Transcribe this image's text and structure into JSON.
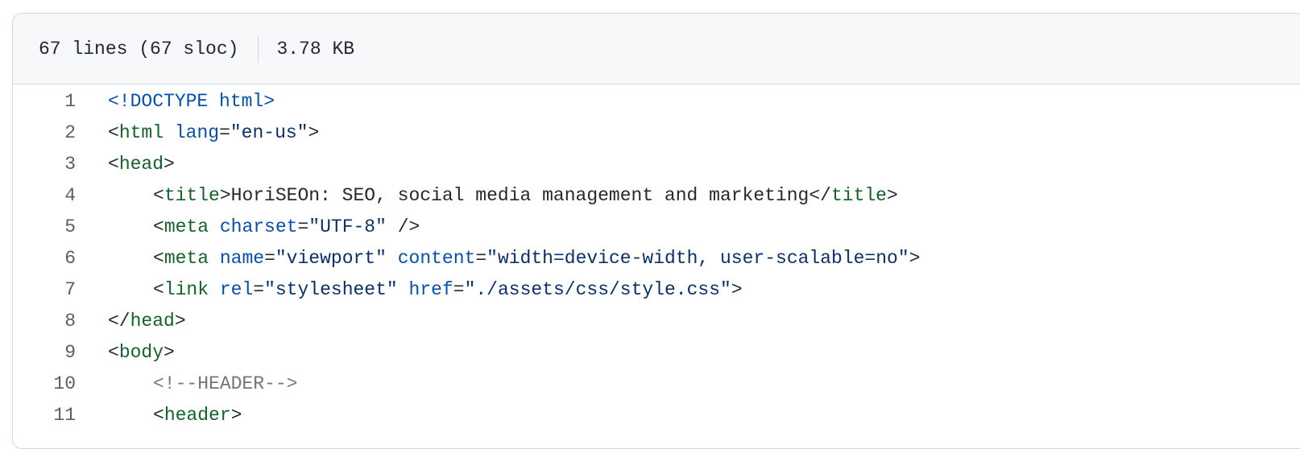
{
  "file_info": {
    "lines": "67 lines (67 sloc)",
    "size": "3.78 KB"
  },
  "code": {
    "l1": {
      "num": "1",
      "doctype": "<!DOCTYPE html>"
    },
    "l2": {
      "num": "2",
      "open": "<",
      "tag": "html",
      "sp": " ",
      "attr1": "lang",
      "eq1": "=",
      "val1": "\"en-us\"",
      "close": ">"
    },
    "l3": {
      "num": "3",
      "open": "<",
      "tag": "head",
      "close": ">"
    },
    "l4": {
      "num": "4",
      "open": "<",
      "tag": "title",
      "close": ">",
      "text": "HoriSEOn: SEO, social media management and marketing",
      "open2": "</",
      "tag2": "title",
      "close2": ">"
    },
    "l5": {
      "num": "5",
      "open": "<",
      "tag": "meta",
      "sp": " ",
      "attr1": "charset",
      "eq1": "=",
      "val1": "\"UTF-8\"",
      "close": " />"
    },
    "l6": {
      "num": "6",
      "open": "<",
      "tag": "meta",
      "sp": " ",
      "attr1": "name",
      "eq1": "=",
      "val1": "\"viewport\"",
      "sp2": " ",
      "attr2": "content",
      "eq2": "=",
      "val2": "\"width=device-width, user-scalable=no\"",
      "close": ">"
    },
    "l7": {
      "num": "7",
      "open": "<",
      "tag": "link",
      "sp": " ",
      "attr1": "rel",
      "eq1": "=",
      "val1": "\"stylesheet\"",
      "sp2": " ",
      "attr2": "href",
      "eq2": "=",
      "val2": "\"./assets/css/style.css\"",
      "close": ">"
    },
    "l8": {
      "num": "8",
      "open": "</",
      "tag": "head",
      "close": ">"
    },
    "l9": {
      "num": "9",
      "open": "<",
      "tag": "body",
      "close": ">"
    },
    "l10": {
      "num": "10",
      "comment": "<!--HEADER-->"
    },
    "l11": {
      "num": "11",
      "open": "<",
      "tag": "header",
      "close": ">"
    }
  }
}
